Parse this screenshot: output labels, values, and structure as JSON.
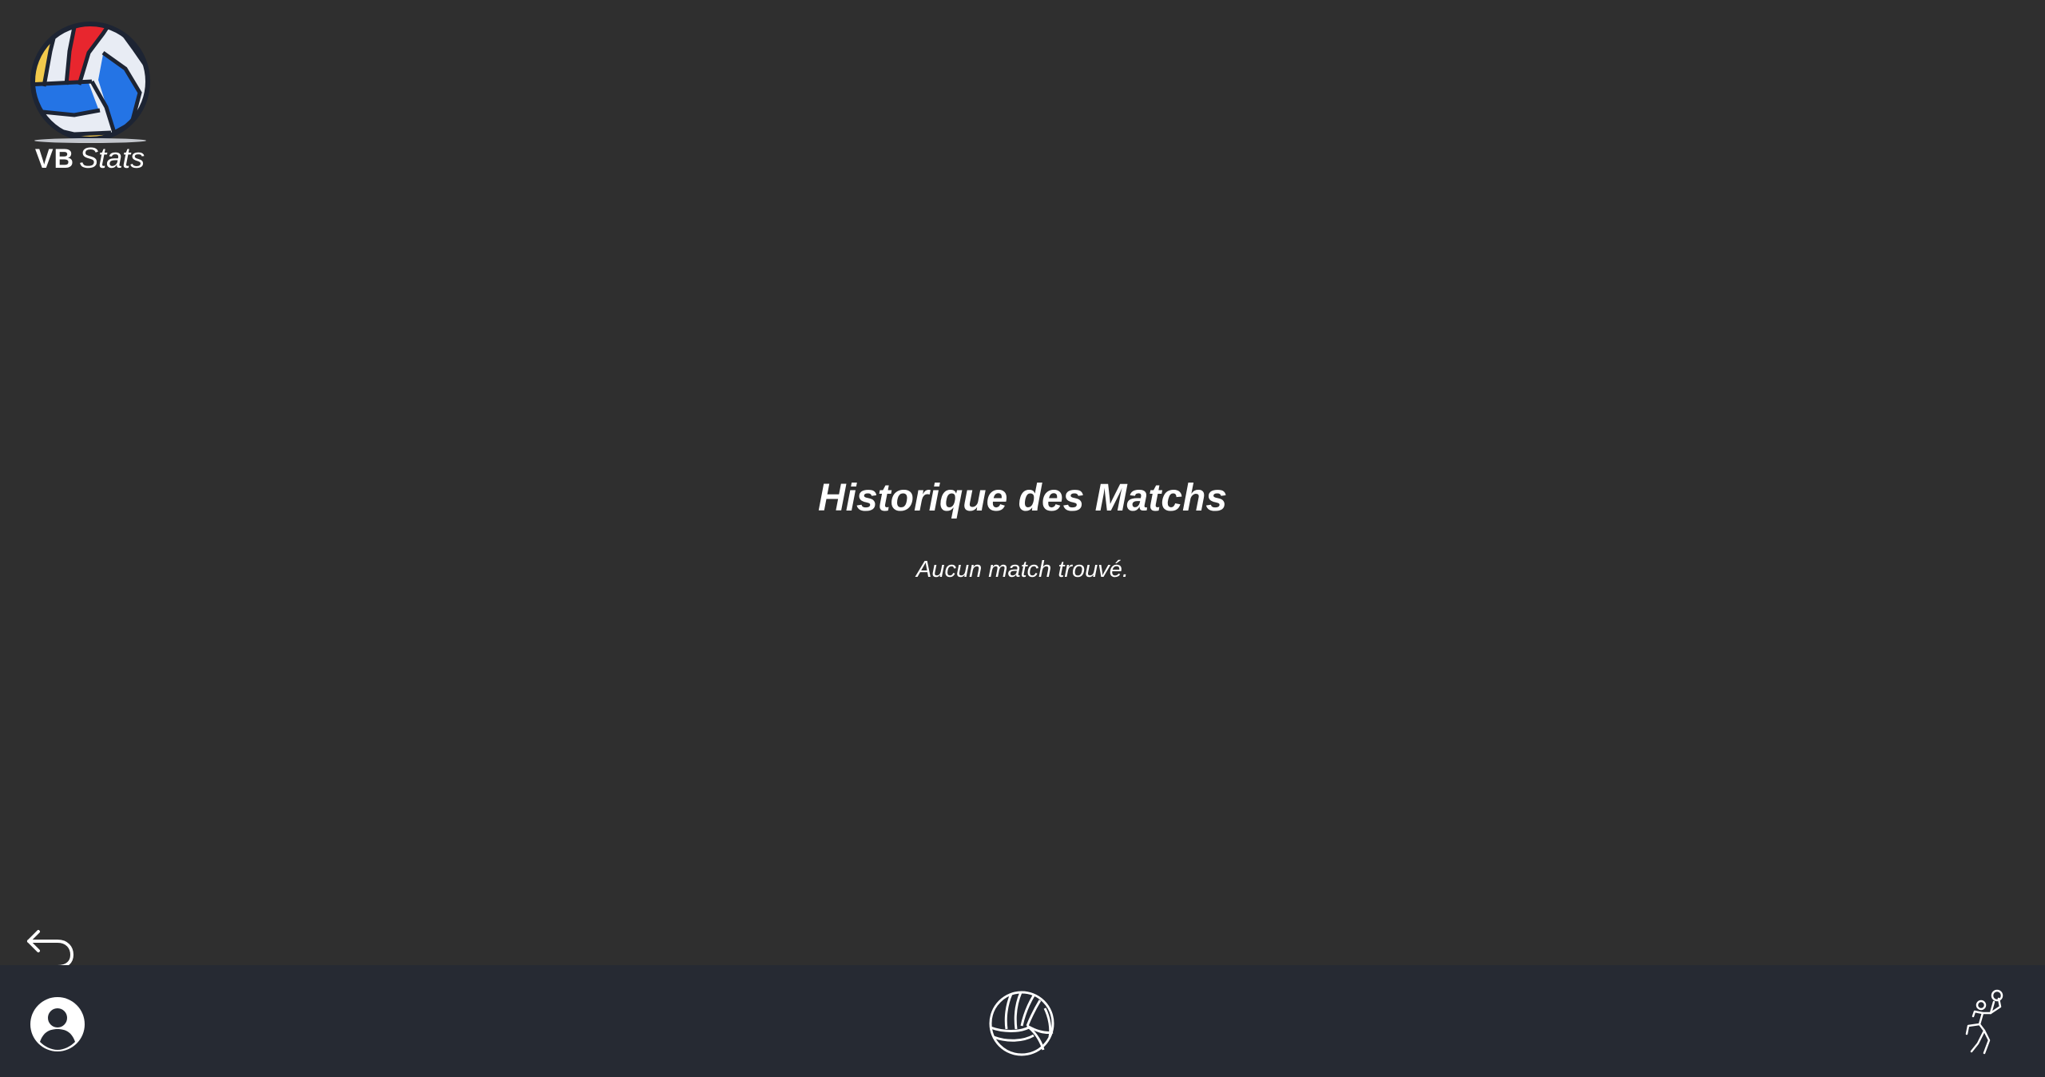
{
  "brand": {
    "logo_vb": "VB",
    "logo_stats": "Stats",
    "colors": {
      "yellow": "#f2c94c",
      "red": "#e8262e",
      "blue": "#2474e5",
      "white": "#e8ecf4",
      "outline": "#1d2433"
    }
  },
  "main": {
    "title": "Historique des Matchs",
    "empty_message": "Aucun match trouvé."
  },
  "controls": {
    "back_icon": "undo-arrow-icon"
  },
  "bottom_nav": {
    "background": "#262a33",
    "items": [
      {
        "icon": "user-circle-icon"
      },
      {
        "icon": "volleyball-icon"
      },
      {
        "icon": "volleyball-player-icon"
      }
    ]
  },
  "theme": {
    "background": "#2f2f2f",
    "text": "#ffffff"
  }
}
